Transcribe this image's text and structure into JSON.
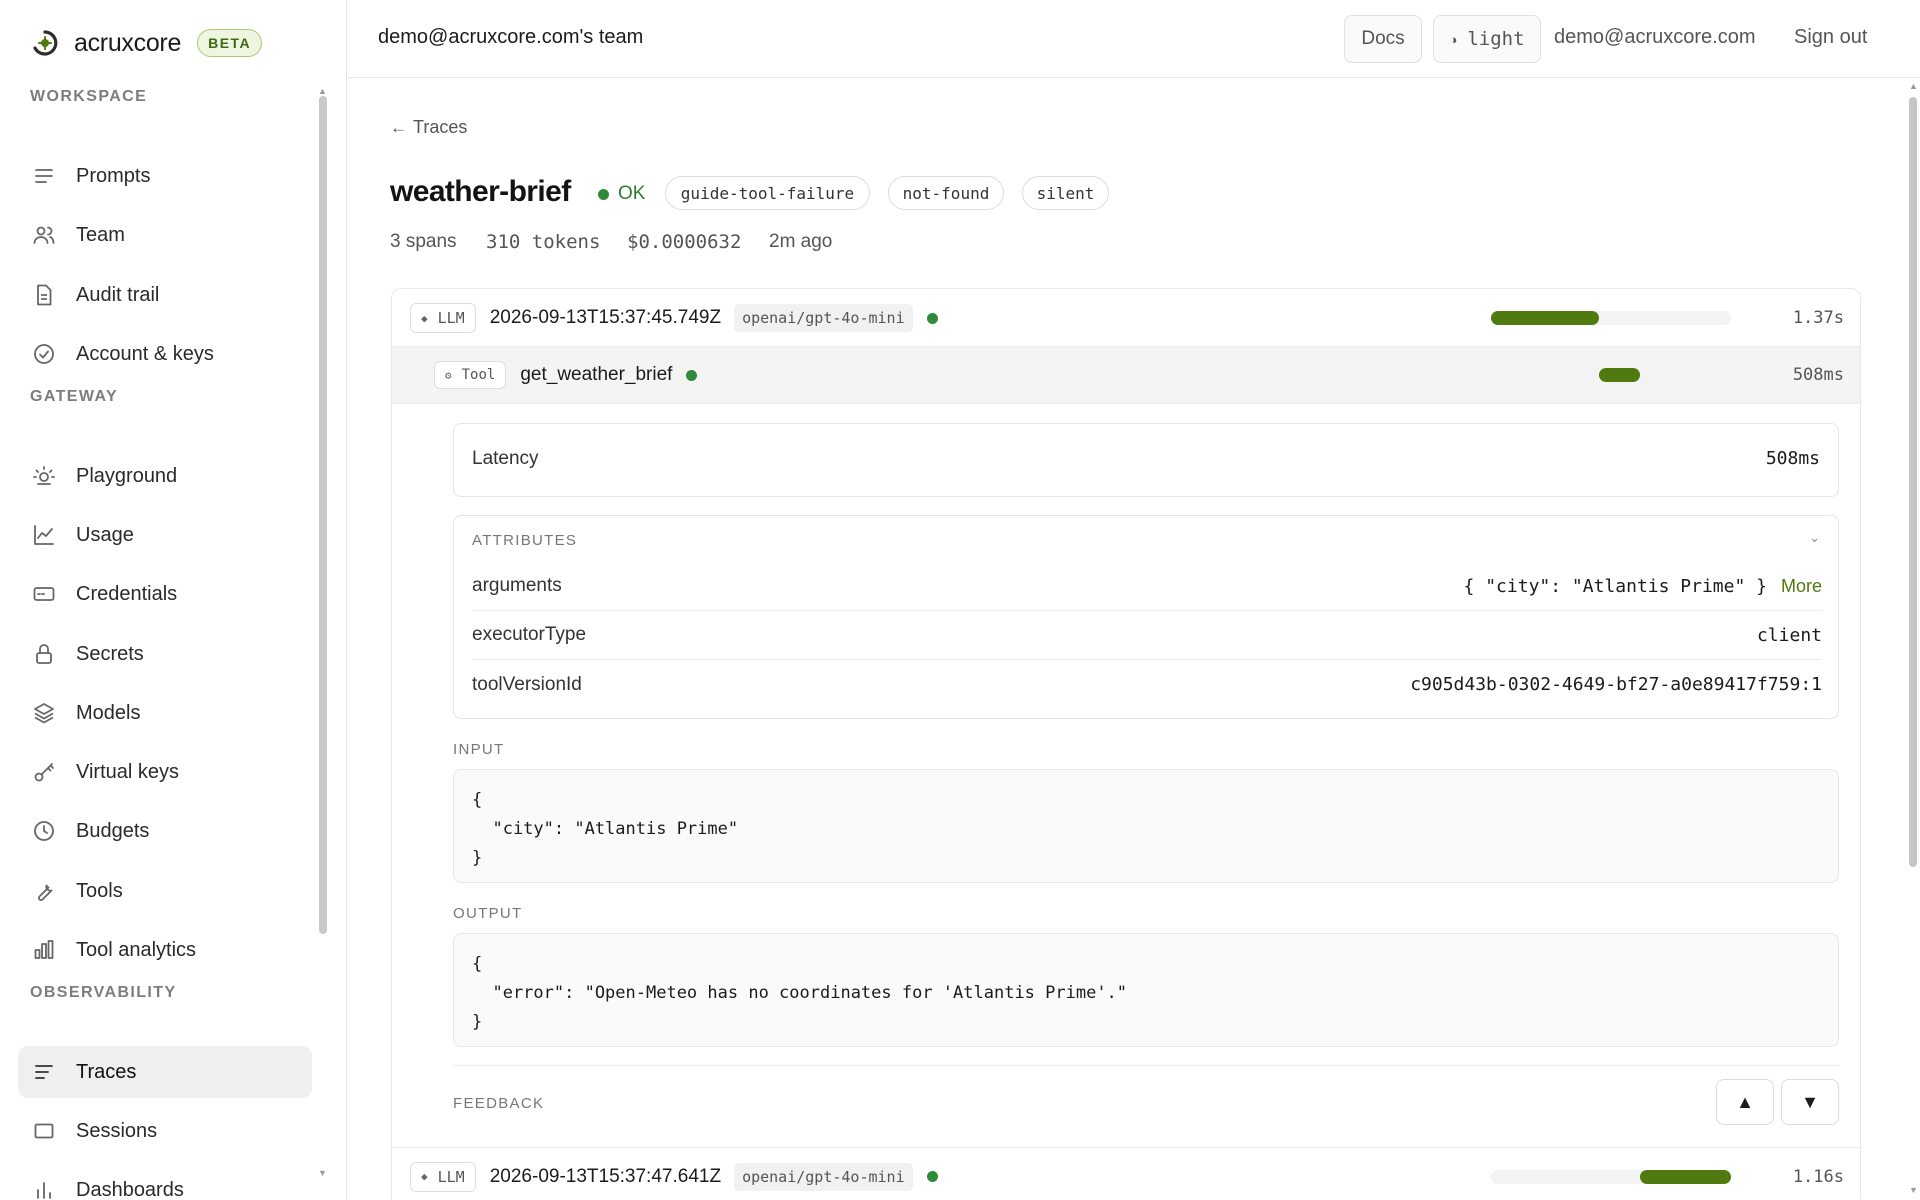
{
  "brand": {
    "name": "acruxcore",
    "badge": "BETA"
  },
  "sidebar": {
    "sections": [
      {
        "title": "WORKSPACE",
        "items": [
          {
            "label": "Prompts",
            "icon": "list-icon"
          },
          {
            "label": "Team",
            "icon": "users-icon"
          },
          {
            "label": "Audit trail",
            "icon": "document-icon"
          },
          {
            "label": "Account & keys",
            "icon": "check-circle-icon"
          }
        ]
      },
      {
        "title": "GATEWAY",
        "items": [
          {
            "label": "Playground",
            "icon": "sun-icon"
          },
          {
            "label": "Usage",
            "icon": "line-chart-icon"
          },
          {
            "label": "Credentials",
            "icon": "card-icon"
          },
          {
            "label": "Secrets",
            "icon": "lock-icon"
          },
          {
            "label": "Models",
            "icon": "layers-icon"
          },
          {
            "label": "Virtual keys",
            "icon": "key-icon"
          },
          {
            "label": "Budgets",
            "icon": "clock-icon"
          },
          {
            "label": "Tools",
            "icon": "wrench-icon"
          },
          {
            "label": "Tool analytics",
            "icon": "bar-chart-icon"
          }
        ]
      },
      {
        "title": "OBSERVABILITY",
        "items": [
          {
            "label": "Traces",
            "icon": "traces-icon",
            "active": true
          },
          {
            "label": "Sessions",
            "icon": "square-icon"
          },
          {
            "label": "Dashboards",
            "icon": "bars-icon"
          }
        ]
      }
    ]
  },
  "topbar": {
    "team": "demo@acruxcore.com's team",
    "docs": "Docs",
    "theme": "light",
    "theme_icon": "◑",
    "email": "demo@acruxcore.com",
    "signout": "Sign out"
  },
  "trace": {
    "back_label": "Traces",
    "back_arrow": "←",
    "title": "weather-brief",
    "status": "OK",
    "tags": [
      "guide-tool-failure",
      "not-found",
      "silent"
    ],
    "spans_count": "3 spans",
    "tokens": "310 tokens",
    "cost": "$0.0000632",
    "age": "2m ago"
  },
  "spans": [
    {
      "kind": "LLM",
      "kind_icon": "◆",
      "name": "2026-09-13T15:37:45.749Z",
      "model": "openai/gpt-4o-mini",
      "duration": "1.37s",
      "bar_start": 0.0,
      "bar_end": 0.45
    },
    {
      "kind": "Tool",
      "kind_icon": "⚙",
      "name": "get_weather_brief",
      "duration": "508ms",
      "bar_start": 0.45,
      "bar_end": 0.62
    },
    {
      "kind": "LLM",
      "kind_icon": "◆",
      "name": "2026-09-13T15:37:47.641Z",
      "model": "openai/gpt-4o-mini",
      "duration": "1.16s",
      "bar_start": 0.62,
      "bar_end": 1.0
    }
  ],
  "detail": {
    "latency_label": "Latency",
    "latency_value": "508ms",
    "attributes_title": "ATTRIBUTES",
    "attributes_chevron": "⌄",
    "attributes": [
      {
        "key": "arguments",
        "value": "{ \"city\": \"Atlantis Prime\" }",
        "more": "More"
      },
      {
        "key": "executorType",
        "value": "client"
      },
      {
        "key": "toolVersionId",
        "value": "c905d43b-0302-4649-bf27-a0e89417f759:1"
      }
    ],
    "input_label": "INPUT",
    "input_code": "{\n  \"city\": \"Atlantis Prime\"\n}",
    "output_label": "OUTPUT",
    "output_code": "{\n  \"error\": \"Open-Meteo has no coordinates for 'Atlantis Prime'.\"\n}",
    "feedback_label": "FEEDBACK",
    "thumbs_up": "▲",
    "thumbs_down": "▼"
  },
  "colors": {
    "accent": "#4f7a0f",
    "ok": "#2e8b3a",
    "badge_bg": "#eef5e1"
  }
}
